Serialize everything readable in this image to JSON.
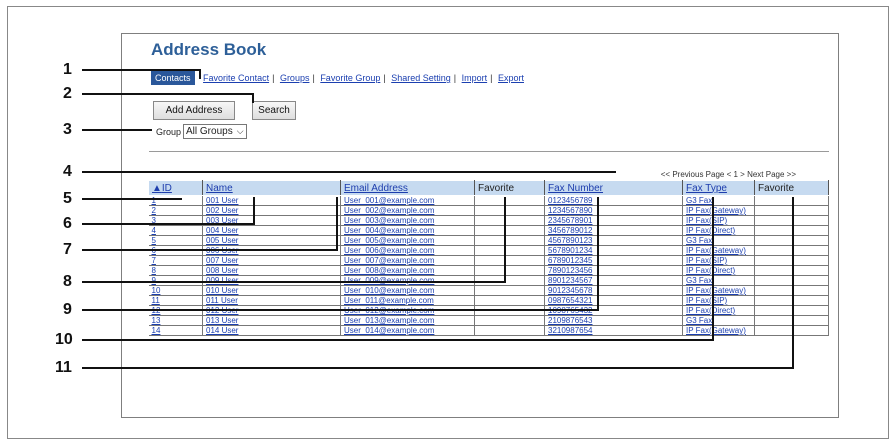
{
  "title": "Address Book",
  "nav": {
    "selected": "Contacts",
    "links": [
      "Favorite Contact",
      "Groups",
      "Favorite Group",
      "Shared Setting",
      "Import",
      "Export"
    ]
  },
  "buttons": {
    "add": "Add Address",
    "search": "Search"
  },
  "group": {
    "label": "Group",
    "value": "All Groups"
  },
  "pager": {
    "prev": "<< Previous Page",
    "current": "< 1 >",
    "next": "Next Page >>"
  },
  "columns": {
    "sort_icon": "▲",
    "id": "ID",
    "name": "Name",
    "email": "Email Address",
    "favorite1": "Favorite",
    "fax_number": "Fax Number",
    "fax_type": "Fax Type",
    "favorite2": "Favorite"
  },
  "rows": [
    {
      "id": "1",
      "name": "001 User",
      "email": "User_001@example.com",
      "fax": "0123456789",
      "type": "G3 Fax"
    },
    {
      "id": "2",
      "name": "002 User",
      "email": "User_002@example.com",
      "fax": "1234567890",
      "type": "IP Fax(Gateway)"
    },
    {
      "id": "3",
      "name": "003 User",
      "email": "User_003@example.com",
      "fax": "2345678901",
      "type": "IP Fax(SIP)"
    },
    {
      "id": "4",
      "name": "004 User",
      "email": "User_004@example.com",
      "fax": "3456789012",
      "type": "IP Fax(Direct)"
    },
    {
      "id": "5",
      "name": "005 User",
      "email": "User_005@example.com",
      "fax": "4567890123",
      "type": "G3 Fax"
    },
    {
      "id": "6",
      "name": "006 User",
      "email": "User_006@example.com",
      "fax": "5678901234",
      "type": "IP Fax(Gateway)"
    },
    {
      "id": "7",
      "name": "007 User",
      "email": "User_007@example.com",
      "fax": "6789012345",
      "type": "IP Fax(SIP)"
    },
    {
      "id": "8",
      "name": "008 User",
      "email": "User_008@example.com",
      "fax": "7890123456",
      "type": "IP Fax(Direct)"
    },
    {
      "id": "9",
      "name": "009 User",
      "email": "User_009@example.com",
      "fax": "8901234567",
      "type": "G3 Fax"
    },
    {
      "id": "10",
      "name": "010 User",
      "email": "User_010@example.com",
      "fax": "9012345678",
      "type": "IP Fax(Gateway)"
    },
    {
      "id": "11",
      "name": "011 User",
      "email": "User_011@example.com",
      "fax": "0987654321",
      "type": "IP Fax(SIP)"
    },
    {
      "id": "12",
      "name": "012 User",
      "email": "User_012@example.com",
      "fax": "1098765432",
      "type": "IP Fax(Direct)"
    },
    {
      "id": "13",
      "name": "013 User",
      "email": "User_013@example.com",
      "fax": "2109876543",
      "type": "G3 Fax"
    },
    {
      "id": "14",
      "name": "014 User",
      "email": "User_014@example.com",
      "fax": "3210987654",
      "type": "IP Fax(Gateway)"
    }
  ],
  "callouts": [
    "1",
    "2",
    "3",
    "4",
    "5",
    "6",
    "7",
    "8",
    "9",
    "10",
    "11"
  ]
}
